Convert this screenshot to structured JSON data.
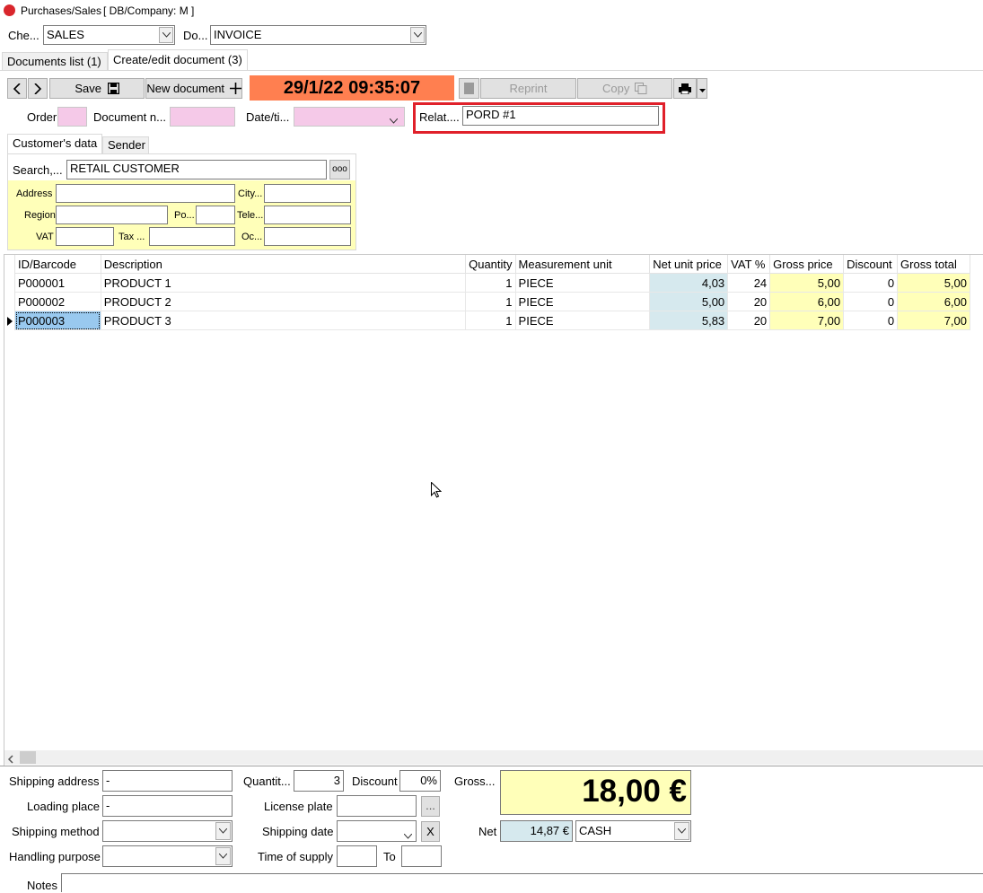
{
  "window": {
    "title": "Purchases/Sales",
    "db_company": "[ DB/Company: M ]"
  },
  "top": {
    "che_label": "Che...",
    "che_value": "SALES",
    "do_label": "Do...",
    "do_value": "INVOICE"
  },
  "tabs": [
    {
      "label": "Documents list (1)"
    },
    {
      "label": "Create/edit document (3)"
    }
  ],
  "toolbar": {
    "save_label": "Save",
    "new_document_label": "New document",
    "datetime": "29/1/22 09:35:07",
    "reprint_label": "Reprint",
    "copy_label": "Copy"
  },
  "header_fields": {
    "order_label": "Order",
    "order_value": "",
    "docnum_label": "Document n...",
    "docnum_value": "",
    "datetime_label": "Date/ti...",
    "datetime_value": "",
    "related_label": "Relat....",
    "related_value": "PORD #1"
  },
  "customer_tabs": [
    {
      "label": "Customer's data"
    },
    {
      "label": "Sender"
    }
  ],
  "customer": {
    "search_label": "Search,...",
    "search_value": "RETAIL CUSTOMER",
    "search_button": "ooo",
    "address_label": "Address",
    "city_label": "City...",
    "region_label": "Region",
    "po_label": "Po...",
    "tele_label": "Tele...",
    "vat_label": "VAT",
    "tax_label": "Tax ...",
    "oc_label": "Oc..."
  },
  "grid": {
    "columns": [
      "ID/Barcode",
      "Description",
      "Quantity",
      "Measurement unit",
      "Net unit price",
      "VAT %",
      "Gross price",
      "Discount",
      "Gross total"
    ],
    "rows": [
      {
        "id": "P000001",
        "desc": "PRODUCT 1",
        "qty": "1",
        "unit": "PIECE",
        "net": "4,03",
        "vat": "24",
        "gross": "5,00",
        "disc": "0",
        "total": "5,00"
      },
      {
        "id": "P000002",
        "desc": "PRODUCT 2",
        "qty": "1",
        "unit": "PIECE",
        "net": "5,00",
        "vat": "20",
        "gross": "6,00",
        "disc": "0",
        "total": "6,00"
      },
      {
        "id": "P000003",
        "desc": "PRODUCT 3",
        "qty": "1",
        "unit": "PIECE",
        "net": "5,83",
        "vat": "20",
        "gross": "7,00",
        "disc": "0",
        "total": "7,00"
      }
    ]
  },
  "bottom": {
    "shipping_address_label": "Shipping address",
    "shipping_address_value": "-",
    "loading_place_label": "Loading place",
    "loading_place_value": "-",
    "shipping_method_label": "Shipping method",
    "handling_purpose_label": "Handling purpose",
    "quantity_label": "Quantit...",
    "quantity_value": "3",
    "discount_label": "Discount",
    "discount_value": "0%",
    "license_plate_label": "License plate",
    "license_button": "...",
    "shipping_date_label": "Shipping date",
    "shipping_date_clear": "X",
    "time_supply_label": "Time of supply",
    "to_label": "To",
    "gross_label": "Gross...",
    "gross_value": "18,00 €",
    "net_label": "Net",
    "net_value": "14,87 €",
    "payment_value": "CASH",
    "notes_label": "Notes"
  },
  "colors": {
    "datetime_bg": "#ff7f50",
    "pink_field": "#f5c9e8",
    "highlight_border": "#e0202a",
    "gross_bg": "#ffffb9",
    "net_bg": "#d6e9ee"
  }
}
